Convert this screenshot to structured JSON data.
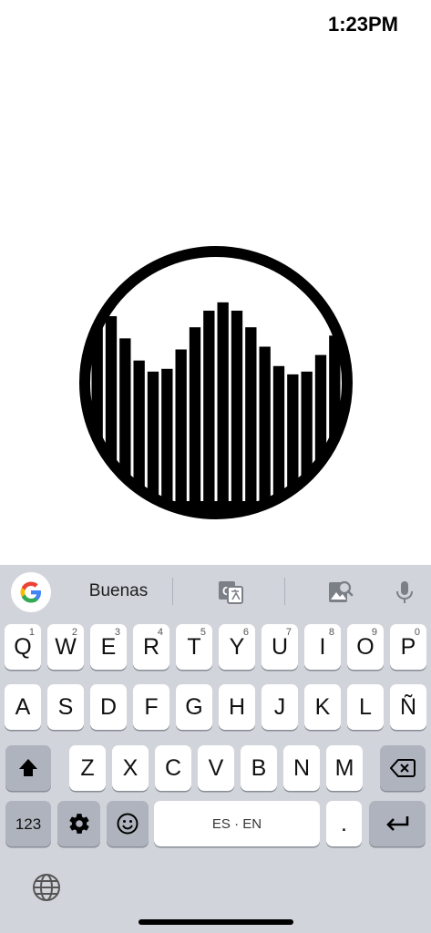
{
  "status": {
    "time": "1:23PM"
  },
  "visualizer": {
    "levels": [
      78,
      74,
      66,
      58,
      54,
      55,
      62,
      70,
      76,
      79,
      76,
      70,
      63,
      56,
      53,
      54,
      60,
      67
    ]
  },
  "toolbar": {
    "suggestion": "Buenas",
    "google_icon": "google-logo-icon",
    "translate_icon": "translate-icon",
    "image_search_icon": "image-search-icon",
    "mic_icon": "microphone-icon"
  },
  "keyboard": {
    "row1": [
      {
        "label": "Q",
        "hint": "1"
      },
      {
        "label": "W",
        "hint": "2"
      },
      {
        "label": "E",
        "hint": "3"
      },
      {
        "label": "R",
        "hint": "4"
      },
      {
        "label": "T",
        "hint": "5"
      },
      {
        "label": "Y",
        "hint": "6"
      },
      {
        "label": "U",
        "hint": "7"
      },
      {
        "label": "I",
        "hint": "8"
      },
      {
        "label": "O",
        "hint": "9"
      },
      {
        "label": "P",
        "hint": "0"
      }
    ],
    "row2": [
      "A",
      "S",
      "D",
      "F",
      "G",
      "H",
      "J",
      "K",
      "L",
      "Ñ"
    ],
    "row3": [
      "Z",
      "X",
      "C",
      "V",
      "B",
      "N",
      "M"
    ],
    "numbers_label": "123",
    "space_label": "ES · EN",
    "period_label": ".",
    "shift_icon": "shift-icon",
    "backspace_icon": "backspace-icon",
    "settings_icon": "gear-icon",
    "emoji_icon": "emoji-icon",
    "return_icon": "return-icon",
    "globe_icon": "globe-icon"
  }
}
